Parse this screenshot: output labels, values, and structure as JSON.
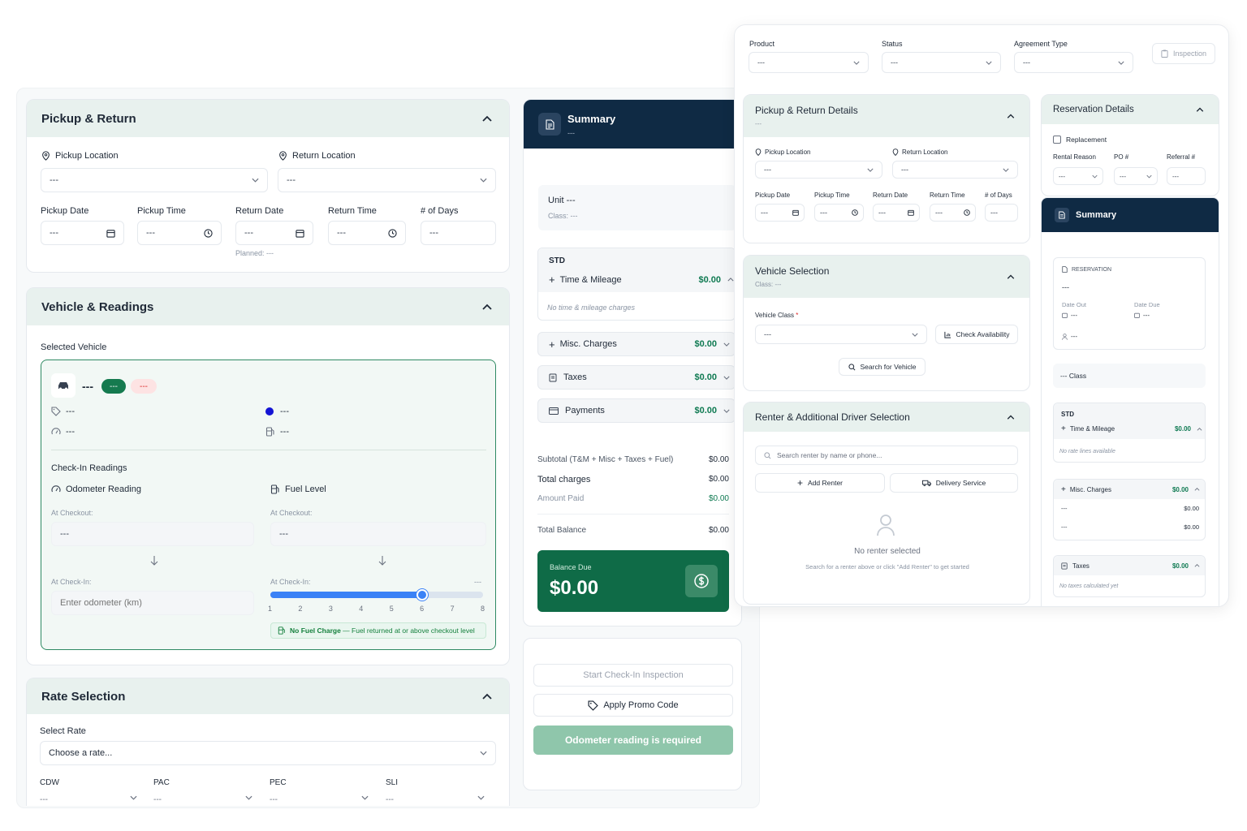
{
  "placeholder": "---",
  "pickup_return": {
    "title": "Pickup & Return",
    "pickup_location_label": "Pickup Location",
    "return_location_label": "Return Location",
    "pickup_date_label": "Pickup Date",
    "pickup_time_label": "Pickup Time",
    "return_date_label": "Return Date",
    "return_time_label": "Return Time",
    "days_label": "# of Days",
    "planned_text": "Planned: ---"
  },
  "vehicle_readings": {
    "title": "Vehicle & Readings",
    "selected_vehicle_label": "Selected Vehicle",
    "vehicle_name": "---",
    "badge_green": "---",
    "badge_red": "---",
    "tag_value": "---",
    "color_value": "---",
    "odometer_value": "---",
    "fuel_value": "---",
    "checkin_readings_label": "Check-In Readings",
    "odometer_label": "Odometer Reading",
    "fuel_label": "Fuel Level",
    "at_checkout_label": "At Checkout:",
    "at_checkin_label": "At Check-In:",
    "odometer_checkout": "---",
    "fuel_checkout": "---",
    "odometer_placeholder": "Enter odometer (km)",
    "fuel_checkin_value": "---",
    "fuel_level": 6,
    "fuel_ticks": [
      "1",
      "2",
      "3",
      "4",
      "5",
      "6",
      "7",
      "8"
    ],
    "fuel_note_bold": "No Fuel Charge",
    "fuel_note_rest": " — Fuel returned at or above checkout level"
  },
  "rate_selection": {
    "title": "Rate Selection",
    "select_rate_label": "Select Rate",
    "select_rate_value": "Choose a rate...",
    "coverages": [
      {
        "label": "CDW",
        "value": "---"
      },
      {
        "label": "PAC",
        "value": "---"
      },
      {
        "label": "PEC",
        "value": "---"
      },
      {
        "label": "SLI",
        "value": "---"
      }
    ]
  },
  "summary_left": {
    "title": "Summary",
    "subtitle": "---",
    "unit_text": "Unit ---",
    "class_text": "Class: ---",
    "std_label": "STD",
    "time_mileage_label": "Time & Mileage",
    "time_mileage_amount": "$0.00",
    "no_tm_text": "No time & mileage charges",
    "misc_label": "Misc. Charges",
    "misc_amount": "$0.00",
    "taxes_label": "Taxes",
    "taxes_amount": "$0.00",
    "payments_label": "Payments",
    "payments_amount": "$0.00",
    "subtotal_label": "Subtotal (T&M + Misc + Taxes + Fuel)",
    "subtotal_amount": "$0.00",
    "total_charges_label": "Total charges",
    "total_charges_amount": "$0.00",
    "amount_paid_label": "Amount Paid",
    "amount_paid_amount": "$0.00",
    "total_balance_label": "Total Balance",
    "total_balance_amount": "$0.00",
    "balance_due_label": "Balance Due",
    "balance_due_amount": "$0.00"
  },
  "actions": {
    "start_inspection": "Start Check-In Inspection",
    "apply_promo": "Apply Promo Code",
    "odometer_required": "Odometer reading is required"
  },
  "right": {
    "product_label": "Product",
    "status_label": "Status",
    "agreement_type_label": "Agreement Type",
    "inspection_button": "Inspection",
    "pickup_details_title": "Pickup & Return Details",
    "pickup_details_sub": "---",
    "pickup_location_label": "Pickup Location",
    "return_location_label": "Return Location",
    "pickup_date_label": "Pickup Date",
    "pickup_time_label": "Pickup Time",
    "return_date_label": "Return Date",
    "return_time_label": "Return Time",
    "days_label": "# of Days",
    "vehicle_selection_title": "Vehicle Selection",
    "vehicle_selection_sub": "Class: ---",
    "vehicle_class_label": "Vehicle Class",
    "required_mark": "*",
    "check_availability": "Check Availability",
    "search_vehicle": "Search for Vehicle",
    "renter_title": "Renter & Additional Driver Selection",
    "renter_search_placeholder": "Search renter by name or phone...",
    "add_renter": "Add Renter",
    "delivery_service": "Delivery Service",
    "no_renter_title": "No renter selected",
    "no_renter_hint": "Search for a renter above or click \"Add Renter\" to get started",
    "reservation_title": "Reservation Details",
    "replacement_label": "Replacement",
    "rental_reason_label": "Rental Reason",
    "po_label": "PO #",
    "referral_label": "Referral #",
    "summary_title": "Summary",
    "reservation_label": "RESERVATION",
    "reservation_value": "---",
    "date_out_label": "Date Out",
    "date_out_value": "---",
    "date_due_label": "Date Due",
    "date_due_value": "---",
    "person_value": "---",
    "class_text": "--- Class",
    "std_label": "STD",
    "time_mileage_label": "Time & Mileage",
    "time_mileage_amount": "$0.00",
    "no_rate_lines": "No rate lines available",
    "misc_label": "Misc. Charges",
    "misc_amount": "$0.00",
    "misc_rows": [
      {
        "label": "---",
        "amount": "$0.00"
      },
      {
        "label": "---",
        "amount": "$0.00"
      }
    ],
    "taxes_label": "Taxes",
    "taxes_amount": "$0.00",
    "no_taxes": "No taxes calculated yet"
  },
  "colors": {
    "dark_navy": "#0f2a44",
    "brand_green": "#0f6b47",
    "section_bg": "#e8f1ee",
    "accent_blue": "#3b82f6"
  }
}
